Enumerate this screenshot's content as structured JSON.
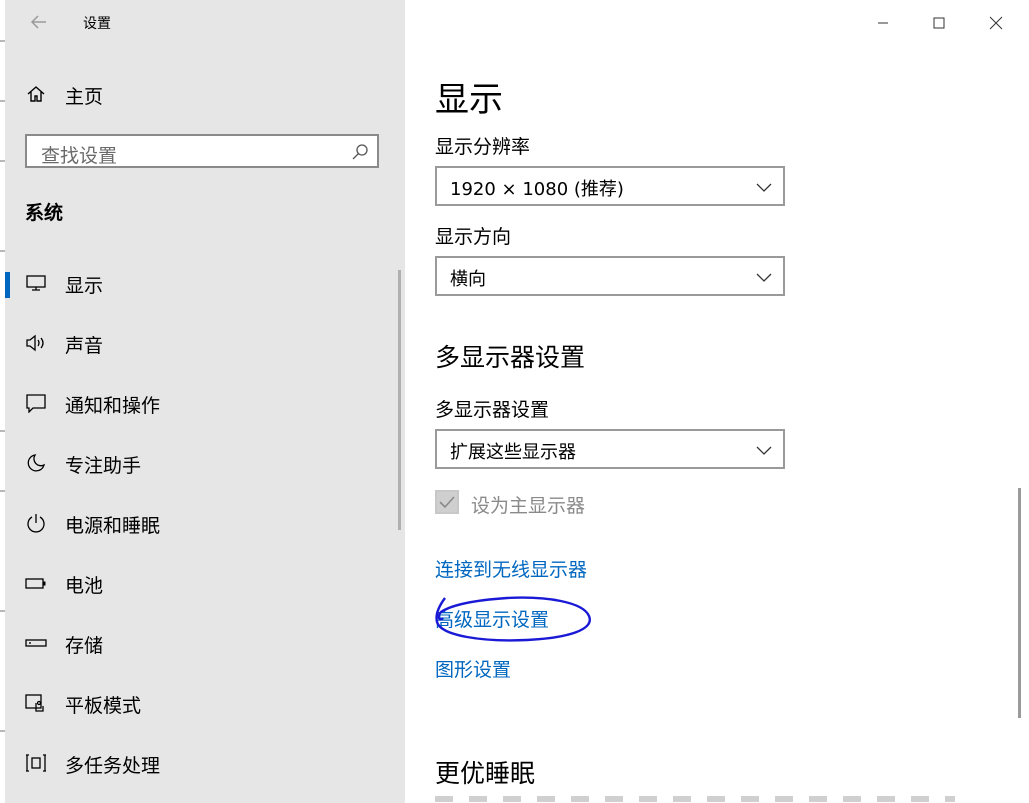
{
  "window": {
    "title": "设置",
    "icons": {
      "back": "arrow-left-icon",
      "minimize": "minimize-icon",
      "maximize": "maximize-icon",
      "close": "close-icon"
    }
  },
  "sidebar": {
    "home": {
      "label": "主页",
      "icon": "home-icon"
    },
    "search": {
      "placeholder": "查找设置",
      "icon": "search-icon"
    },
    "section": "系统",
    "items": [
      {
        "label": "显示",
        "icon": "monitor-icon",
        "active": true
      },
      {
        "label": "声音",
        "icon": "speaker-icon"
      },
      {
        "label": "通知和操作",
        "icon": "notification-icon"
      },
      {
        "label": "专注助手",
        "icon": "moon-icon"
      },
      {
        "label": "电源和睡眠",
        "icon": "power-icon"
      },
      {
        "label": "电池",
        "icon": "battery-icon"
      },
      {
        "label": "存储",
        "icon": "storage-icon"
      },
      {
        "label": "平板模式",
        "icon": "tablet-icon"
      },
      {
        "label": "多任务处理",
        "icon": "multitask-icon"
      }
    ]
  },
  "main": {
    "title": "显示",
    "resolution": {
      "label": "显示分辨率",
      "value": "1920 × 1080 (推荐)"
    },
    "orientation": {
      "label": "显示方向",
      "value": "横向"
    },
    "multi": {
      "heading": "多显示器设置",
      "label": "多显示器设置",
      "value": "扩展这些显示器",
      "checkbox": "设为主显示器"
    },
    "links": [
      "连接到无线显示器",
      "高级显示设置",
      "图形设置"
    ],
    "next_heading": "更优睡眠"
  },
  "colors": {
    "accent": "#0067c0",
    "sidebar_bg": "#e6e6e6",
    "annotation": "#1a1ad6"
  }
}
